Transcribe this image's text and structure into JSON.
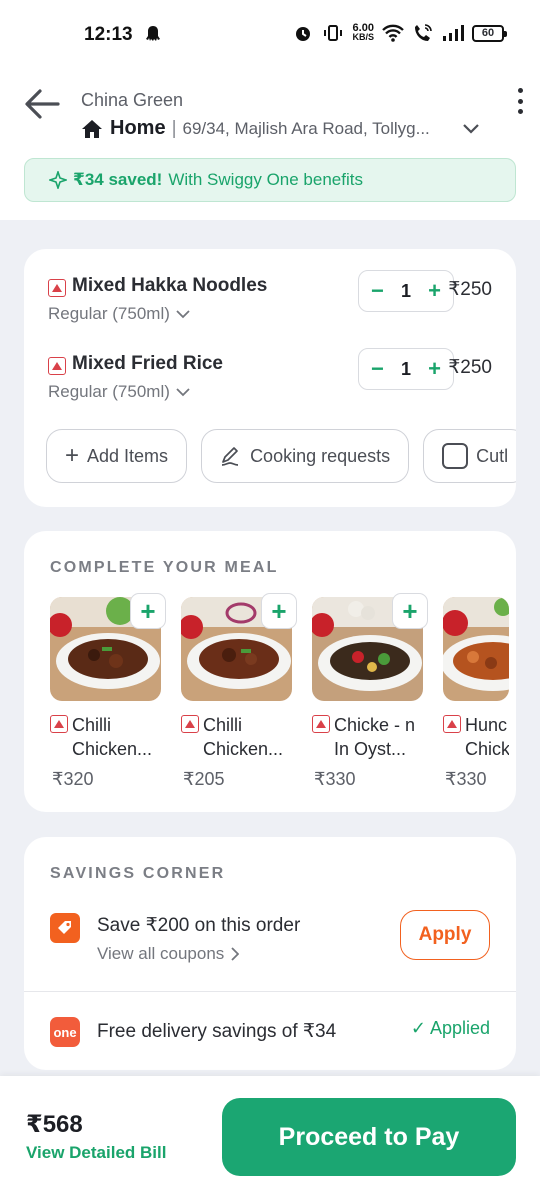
{
  "status_bar": {
    "time": "12:13",
    "net_speed_value": "6.00",
    "net_speed_unit": "KB/S",
    "battery": "60"
  },
  "header": {
    "restaurant": "China Green",
    "address_label": "Home",
    "address_separator": "|",
    "address_text": "69/34, Majlish Ara Road, Tollyg..."
  },
  "savings_banner": {
    "amount": "₹34 saved!",
    "text": "With Swiggy One benefits"
  },
  "cart": {
    "items": [
      {
        "name": "Mixed Hakka Noodles",
        "variant": "Regular (750ml)",
        "qty": "1",
        "price": "₹250"
      },
      {
        "name": "Mixed Fried Rice",
        "variant": "Regular (750ml)",
        "qty": "1",
        "price": "₹250"
      }
    ],
    "actions": {
      "add_items": "Add Items",
      "cooking_requests": "Cooking requests",
      "cutlery": "Cutl"
    }
  },
  "complete_meal": {
    "title": "COMPLETE YOUR MEAL",
    "items": [
      {
        "name": "Chilli Chicken...",
        "price": "₹320"
      },
      {
        "name": "Chilli Chicken...",
        "price": "₹205"
      },
      {
        "name": "Chicke - n In Oyst...",
        "price": "₹330"
      },
      {
        "name": "Hunc Chicker",
        "price": "₹330"
      }
    ]
  },
  "savings_corner": {
    "title": "SAVINGS CORNER",
    "coupon_title": "Save ₹200 on this order",
    "coupon_sub": "View all coupons",
    "apply": "Apply",
    "one_badge": "one",
    "delivery_text": "Free delivery savings of ₹34",
    "applied": "✓ Applied"
  },
  "footer": {
    "total": "₹568",
    "bill_link": "View Detailed Bill",
    "pay_button": "Proceed to Pay"
  },
  "colors": {
    "accent_green": "#1ba672",
    "accent_orange": "#f2611f",
    "nonveg_red": "#d94149"
  }
}
